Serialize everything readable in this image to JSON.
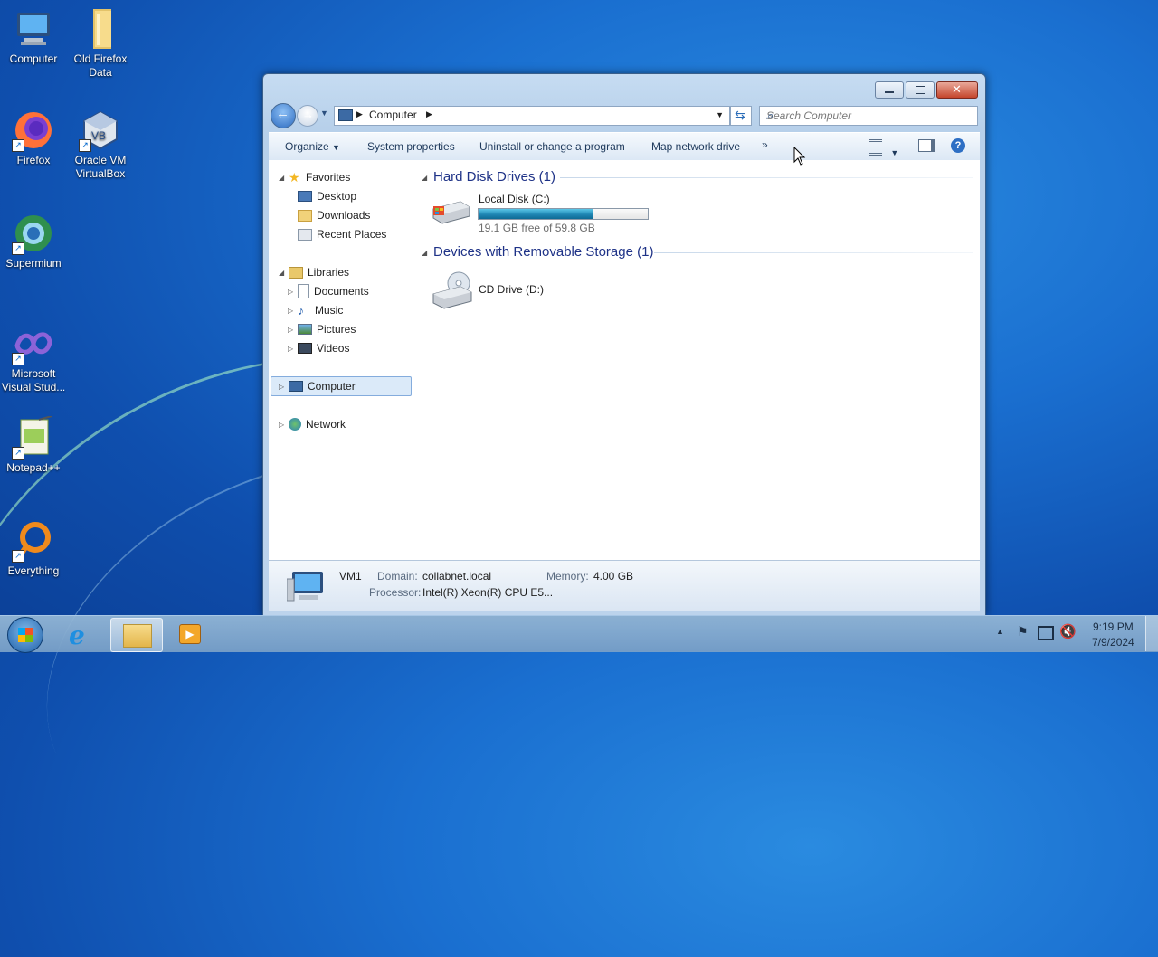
{
  "desktop": {
    "icons": [
      {
        "label": "Computer"
      },
      {
        "label": "Old Firefox Data"
      },
      {
        "label": "Firefox"
      },
      {
        "label": "Oracle VM VirtualBox"
      },
      {
        "label": "Supermium"
      },
      {
        "label": "Microsoft Visual Stud..."
      },
      {
        "label": "Notepad++"
      },
      {
        "label": "Everything"
      }
    ]
  },
  "window": {
    "address": {
      "crumb": "Computer"
    },
    "search": {
      "placeholder": "Search Computer"
    },
    "toolbar": {
      "organize": "Organize",
      "system_properties": "System properties",
      "uninstall": "Uninstall or change a program",
      "map_drive": "Map network drive",
      "more": "»"
    },
    "nav": {
      "favorites": "Favorites",
      "desktop": "Desktop",
      "downloads": "Downloads",
      "recent": "Recent Places",
      "libraries": "Libraries",
      "documents": "Documents",
      "music": "Music",
      "pictures": "Pictures",
      "videos": "Videos",
      "computer": "Computer",
      "network": "Network"
    },
    "sections": {
      "hdd_title": "Hard Disk Drives (1)",
      "removable_title": "Devices with Removable Storage (1)"
    },
    "drives": {
      "c_name": "Local Disk (C:)",
      "c_free": "19.1 GB free of 59.8 GB",
      "c_used_fraction": 0.68,
      "d_name": "CD Drive (D:)"
    },
    "status": {
      "name": "VM1",
      "domain_label": "Domain:",
      "domain_value": "collabnet.local",
      "memory_label": "Memory:",
      "memory_value": "4.00 GB",
      "processor_label": "Processor:",
      "processor_value": "Intel(R) Xeon(R) CPU E5..."
    }
  },
  "taskbar": {
    "time": "9:19 PM",
    "date": "7/9/2024"
  }
}
